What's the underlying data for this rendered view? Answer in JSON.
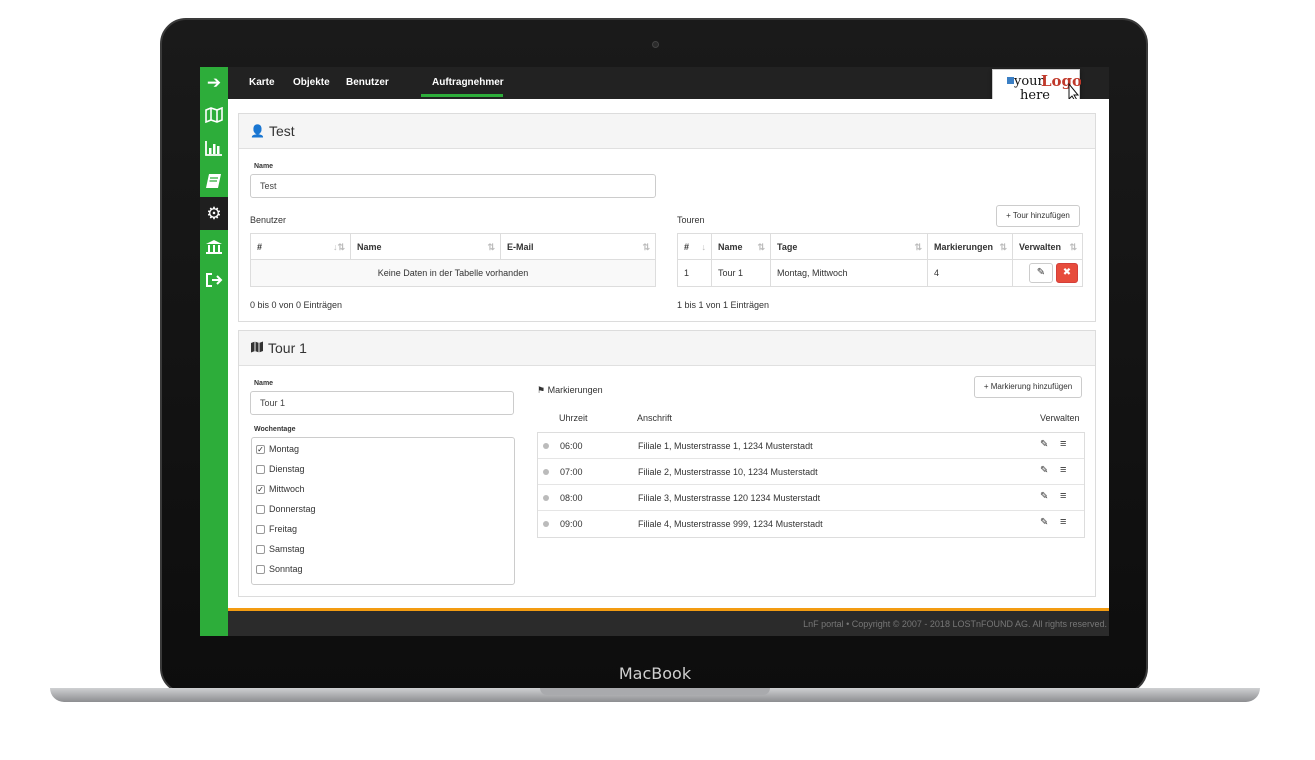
{
  "device": {
    "brand": "MacBook"
  },
  "sidebar": {
    "icons": [
      "arrow-right-icon",
      "map-icon",
      "bar-chart-icon",
      "book-icon",
      "gear-icon",
      "bank-icon",
      "sign-out-icon"
    ],
    "active_index": 4
  },
  "nav": {
    "tabs": [
      "Karte",
      "Objekte",
      "Benutzer",
      "Auftragnehmer"
    ],
    "active": "Auftragnehmer"
  },
  "logo": {
    "text_a": "your",
    "text_b": "Logo",
    "text_c": "here"
  },
  "contractor": {
    "title": "Test",
    "name_label": "Name",
    "name_value": "Test",
    "users_label": "Benutzer",
    "users_columns": [
      "#",
      "Name",
      "E-Mail"
    ],
    "users_empty": "Keine Daten in der Tabelle vorhanden",
    "users_info": "0 bis 0 von 0 Einträgen",
    "tours_label": "Touren",
    "add_tour": "+ Tour hinzufügen",
    "tours_columns": [
      "#",
      "Name",
      "Tage",
      "Markierungen",
      "Verwalten"
    ],
    "tours_rows": [
      {
        "num": "1",
        "name": "Tour 1",
        "days": "Montag, Mittwoch",
        "markers": "4"
      }
    ],
    "tours_info": "1 bis 1 von 1 Einträgen"
  },
  "tour": {
    "title": "Tour 1",
    "name_label": "Name",
    "name_value": "Tour 1",
    "weekdays_label": "Wochentage",
    "weekdays": [
      {
        "label": "Montag",
        "checked": true
      },
      {
        "label": "Dienstag",
        "checked": false
      },
      {
        "label": "Mittwoch",
        "checked": true
      },
      {
        "label": "Donnerstag",
        "checked": false
      },
      {
        "label": "Freitag",
        "checked": false
      },
      {
        "label": "Samstag",
        "checked": false
      },
      {
        "label": "Sonntag",
        "checked": false
      }
    ],
    "markers_label": "Markierungen",
    "add_marker": "+ Markierung hinzufügen",
    "col_time": "Uhrzeit",
    "col_address": "Anschrift",
    "col_manage": "Verwalten",
    "markers": [
      {
        "time": "06:00",
        "address": "Filiale 1, Musterstrasse 1, 1234 Musterstadt"
      },
      {
        "time": "07:00",
        "address": "Filiale 2, Musterstrasse 10, 1234 Musterstadt"
      },
      {
        "time": "08:00",
        "address": "Filiale 3, Musterstrasse 120 1234 Musterstadt"
      },
      {
        "time": "09:00",
        "address": "Filiale 4, Musterstrasse 999, 1234 Musterstadt"
      }
    ]
  },
  "footer": {
    "text": "LnF portal • Copyright © 2007 - 2018 LOSTnFOUND AG. All rights reserved."
  }
}
